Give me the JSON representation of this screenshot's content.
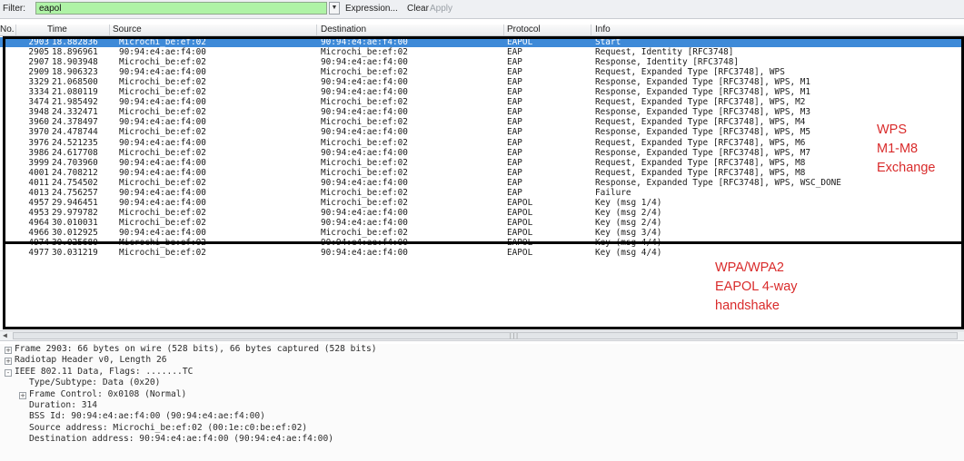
{
  "filter": {
    "label": "Filter:",
    "value": "eapol",
    "expression_label": "Expression...",
    "clear_label": "Clear",
    "apply_label": "Apply"
  },
  "columns": {
    "no": "No.",
    "time": "Time",
    "source": "Source",
    "destination": "Destination",
    "protocol": "Protocol",
    "info": "Info"
  },
  "packets": [
    {
      "no": "2903",
      "time": "18.882836",
      "source": "Microchi_be:ef:02",
      "destination": "90:94:e4:ae:f4:00",
      "protocol": "EAPOL",
      "info": "Start"
    },
    {
      "no": "2905",
      "time": "18.896961",
      "source": "90:94:e4:ae:f4:00",
      "destination": "Microchi_be:ef:02",
      "protocol": "EAP",
      "info": "Request, Identity [RFC3748]"
    },
    {
      "no": "2907",
      "time": "18.903948",
      "source": "Microchi_be:ef:02",
      "destination": "90:94:e4:ae:f4:00",
      "protocol": "EAP",
      "info": "Response, Identity [RFC3748]"
    },
    {
      "no": "2909",
      "time": "18.906323",
      "source": "90:94:e4:ae:f4:00",
      "destination": "Microchi_be:ef:02",
      "protocol": "EAP",
      "info": "Request, Expanded Type [RFC3748], WPS"
    },
    {
      "no": "3329",
      "time": "21.068500",
      "source": "Microchi_be:ef:02",
      "destination": "90:94:e4:ae:f4:00",
      "protocol": "EAP",
      "info": "Response, Expanded Type [RFC3748], WPS, M1"
    },
    {
      "no": "3334",
      "time": "21.080119",
      "source": "Microchi_be:ef:02",
      "destination": "90:94:e4:ae:f4:00",
      "protocol": "EAP",
      "info": "Response, Expanded Type [RFC3748], WPS, M1"
    },
    {
      "no": "3474",
      "time": "21.985492",
      "source": "90:94:e4:ae:f4:00",
      "destination": "Microchi_be:ef:02",
      "protocol": "EAP",
      "info": "Request, Expanded Type [RFC3748], WPS, M2"
    },
    {
      "no": "3948",
      "time": "24.332471",
      "source": "Microchi_be:ef:02",
      "destination": "90:94:e4:ae:f4:00",
      "protocol": "EAP",
      "info": "Response, Expanded Type [RFC3748], WPS, M3"
    },
    {
      "no": "3960",
      "time": "24.378497",
      "source": "90:94:e4:ae:f4:00",
      "destination": "Microchi_be:ef:02",
      "protocol": "EAP",
      "info": "Request, Expanded Type [RFC3748], WPS, M4"
    },
    {
      "no": "3970",
      "time": "24.478744",
      "source": "Microchi_be:ef:02",
      "destination": "90:94:e4:ae:f4:00",
      "protocol": "EAP",
      "info": "Response, Expanded Type [RFC3748], WPS, M5"
    },
    {
      "no": "3976",
      "time": "24.521235",
      "source": "90:94:e4:ae:f4:00",
      "destination": "Microchi_be:ef:02",
      "protocol": "EAP",
      "info": "Request, Expanded Type [RFC3748], WPS, M6"
    },
    {
      "no": "3986",
      "time": "24.617708",
      "source": "Microchi_be:ef:02",
      "destination": "90:94:e4:ae:f4:00",
      "protocol": "EAP",
      "info": "Response, Expanded Type [RFC3748], WPS, M7"
    },
    {
      "no": "3999",
      "time": "24.703960",
      "source": "90:94:e4:ae:f4:00",
      "destination": "Microchi_be:ef:02",
      "protocol": "EAP",
      "info": "Request, Expanded Type [RFC3748], WPS, M8"
    },
    {
      "no": "4001",
      "time": "24.708212",
      "source": "90:94:e4:ae:f4:00",
      "destination": "Microchi_be:ef:02",
      "protocol": "EAP",
      "info": "Request, Expanded Type [RFC3748], WPS, M8"
    },
    {
      "no": "4011",
      "time": "24.754502",
      "source": "Microchi_be:ef:02",
      "destination": "90:94:e4:ae:f4:00",
      "protocol": "EAP",
      "info": "Response, Expanded Type [RFC3748], WPS, WSC_DONE"
    },
    {
      "no": "4013",
      "time": "24.756257",
      "source": "90:94:e4:ae:f4:00",
      "destination": "Microchi_be:ef:02",
      "protocol": "EAP",
      "info": "Failure"
    },
    {
      "no": "4957",
      "time": "29.946451",
      "source": "90:94:e4:ae:f4:00",
      "destination": "Microchi_be:ef:02",
      "protocol": "EAPOL",
      "info": "Key (msg 1/4)"
    },
    {
      "no": "4953",
      "time": "29.979782",
      "source": "Microchi_be:ef:02",
      "destination": "90:94:e4:ae:f4:00",
      "protocol": "EAPOL",
      "info": "Key (msg 2/4)"
    },
    {
      "no": "4964",
      "time": "30.010031",
      "source": "Microchi_be:ef:02",
      "destination": "90:94:e4:ae:f4:00",
      "protocol": "EAPOL",
      "info": "Key (msg 2/4)"
    },
    {
      "no": "4966",
      "time": "30.012925",
      "source": "90:94:e4:ae:f4:00",
      "destination": "Microchi_be:ef:02",
      "protocol": "EAPOL",
      "info": "Key (msg 3/4)"
    },
    {
      "no": "4974",
      "time": "30.025680",
      "source": "Microchi_be:ef:02",
      "destination": "90:94:e4:ae:f4:00",
      "protocol": "EAPOL",
      "info": "Key (msg 4/4)"
    },
    {
      "no": "4977",
      "time": "30.031219",
      "source": "Microchi_be:ef:02",
      "destination": "90:94:e4:ae:f4:00",
      "protocol": "EAPOL",
      "info": "Key (msg 4/4)"
    }
  ],
  "annotations": {
    "wps": [
      "WPS",
      "M1-M8",
      "Exchange"
    ],
    "wpa": [
      "WPA/WPA2",
      "EAPOL 4-way",
      "handshake"
    ]
  },
  "details": [
    {
      "toggle": "+",
      "text": "Frame 2903: 66 bytes on wire (528 bits), 66 bytes captured (528 bits)"
    },
    {
      "toggle": "+",
      "text": "Radiotap Header v0, Length 26"
    },
    {
      "toggle": "-",
      "text": "IEEE 802.11 Data, Flags: .......TC"
    },
    {
      "toggle": "",
      "text": "Type/Subtype: Data (0x20)"
    },
    {
      "toggle": "+",
      "text": "Frame Control: 0x0108 (Normal)"
    },
    {
      "toggle": "",
      "text": "Duration: 314"
    },
    {
      "toggle": "",
      "text": "BSS Id: 90:94:e4:ae:f4:00 (90:94:e4:ae:f4:00)"
    },
    {
      "toggle": "",
      "text": "Source address: Microchi_be:ef:02 (00:1e:c0:be:ef:02)"
    },
    {
      "toggle": "",
      "text": "Destination address: 90:94:e4:ae:f4:00 (90:94:e4:ae:f4:00)"
    }
  ],
  "colors": {
    "filter_bg": "#aff3a6",
    "selected_row": "#3e8ad8",
    "annotation": "#d92b2b"
  }
}
